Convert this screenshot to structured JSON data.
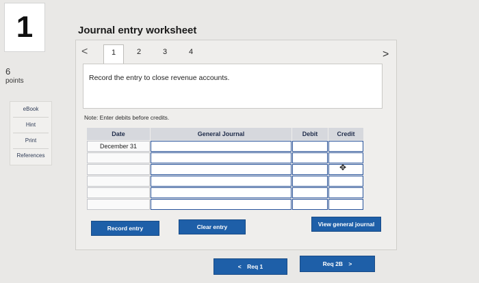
{
  "question": {
    "number": "1",
    "points_value": "6",
    "points_label": "points"
  },
  "sidebar": {
    "links": [
      {
        "label": "eBook"
      },
      {
        "label": "Hint"
      },
      {
        "label": "Print"
      },
      {
        "label": "References"
      }
    ]
  },
  "worksheet": {
    "title": "Journal entry worksheet",
    "nav_prev": "<",
    "nav_next": ">",
    "tabs": [
      {
        "label": "1",
        "active": true
      },
      {
        "label": "2",
        "active": false
      },
      {
        "label": "3",
        "active": false
      },
      {
        "label": "4",
        "active": false
      }
    ],
    "prompt": "Record the entry to close revenue accounts.",
    "note": "Note: Enter debits before credits."
  },
  "journal": {
    "headers": {
      "date": "Date",
      "general_journal": "General Journal",
      "debit": "Debit",
      "credit": "Credit"
    },
    "rows": [
      {
        "date": "December 31",
        "account": "",
        "debit": "",
        "credit": ""
      },
      {
        "date": "",
        "account": "",
        "debit": "",
        "credit": ""
      },
      {
        "date": "",
        "account": "",
        "debit": "",
        "credit": ""
      },
      {
        "date": "",
        "account": "",
        "debit": "",
        "credit": ""
      },
      {
        "date": "",
        "account": "",
        "debit": "",
        "credit": ""
      },
      {
        "date": "",
        "account": "",
        "debit": "",
        "credit": ""
      }
    ]
  },
  "buttons": {
    "record_entry": "Record entry",
    "clear_entry": "Clear entry",
    "view_general_journal": "View general journal"
  },
  "pager": {
    "prev": {
      "chevron": "<",
      "label": "Req 1"
    },
    "next": {
      "label": "Req 2B",
      "chevron": ">"
    }
  },
  "colors": {
    "button_blue": "#1e5fa8",
    "header_gray": "#d6d8dd",
    "input_border": "#24509a"
  }
}
